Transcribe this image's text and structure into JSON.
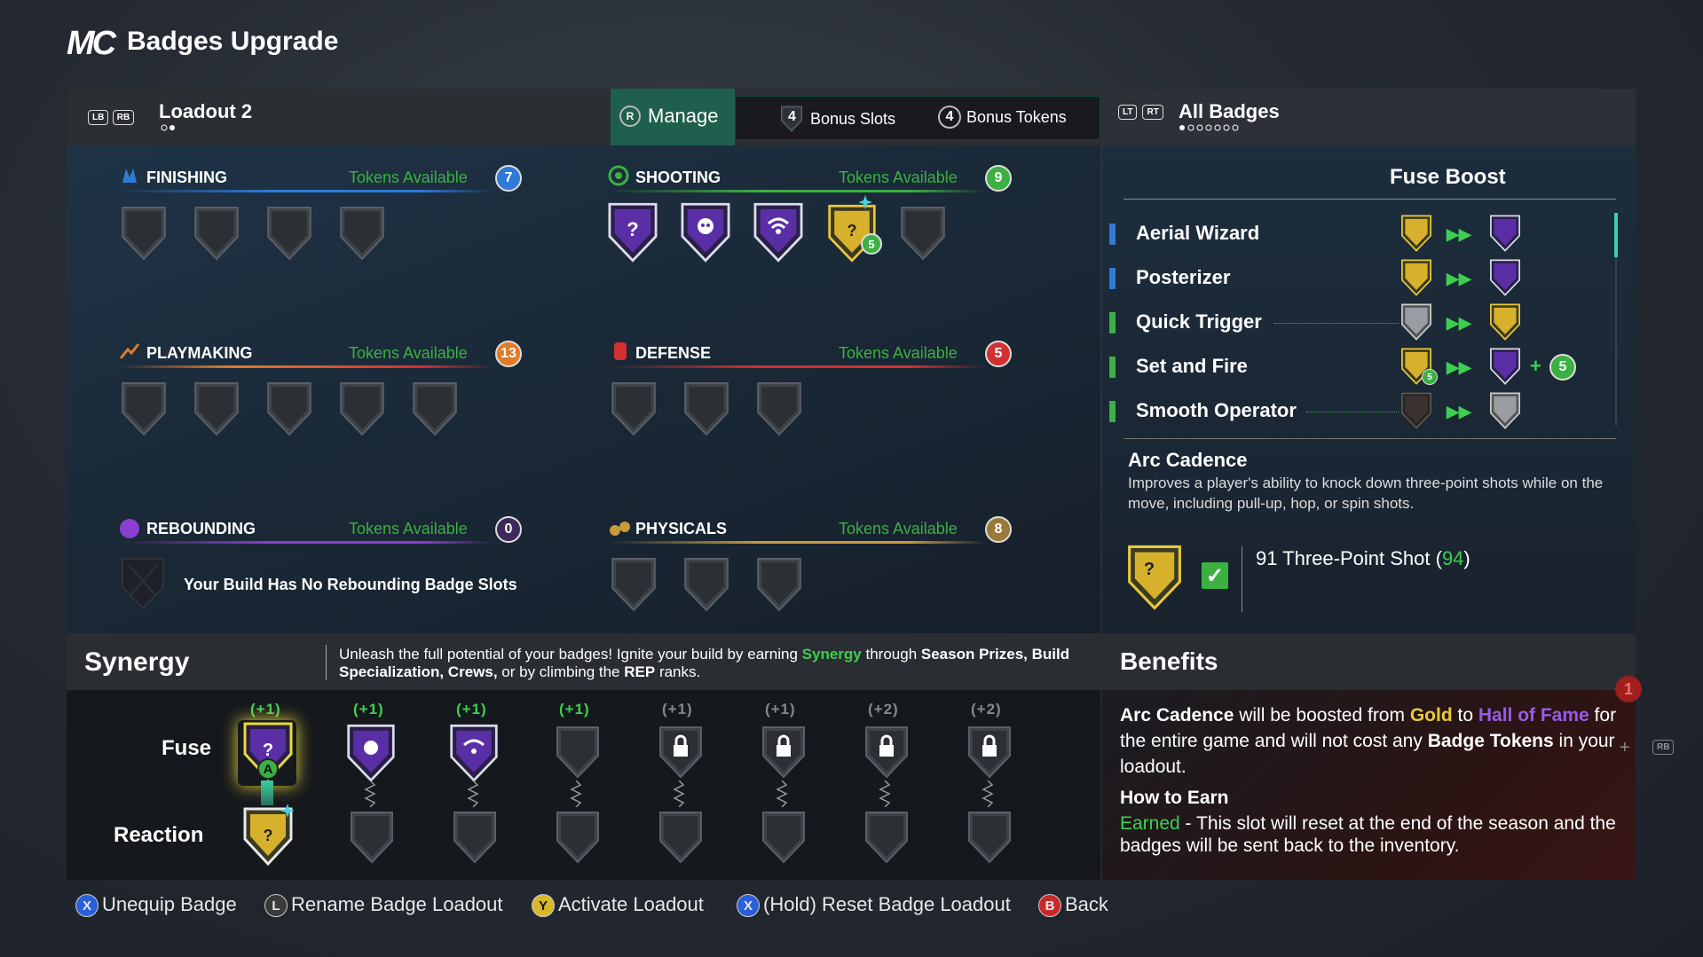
{
  "header": {
    "logo": "MC",
    "title": "Badges Upgrade"
  },
  "topbar": {
    "lb": "LB",
    "rb": "RB",
    "loadout_name": "Loadout 2",
    "manage_btn": "R",
    "manage_label": "Manage",
    "bonus_slots_count": "4",
    "bonus_slots_label": "Bonus Slots",
    "bonus_tokens_count": "4",
    "bonus_tokens_label": "Bonus Tokens",
    "lt": "LT",
    "rt": "RT",
    "all_badges_label": "All Badges"
  },
  "categories": {
    "finishing": {
      "name": "FINISHING",
      "tokens_label": "Tokens Available",
      "tokens": "7",
      "color": "#2f7ad8"
    },
    "shooting": {
      "name": "SHOOTING",
      "tokens_label": "Tokens Available",
      "tokens": "9",
      "color": "#3cb043",
      "badge_count": "5"
    },
    "playmaking": {
      "name": "PLAYMAKING",
      "tokens_label": "Tokens Available",
      "tokens": "13",
      "color": "#e07b2a"
    },
    "defense": {
      "name": "DEFENSE",
      "tokens_label": "Tokens Available",
      "tokens": "5",
      "color": "#d33030"
    },
    "rebounding": {
      "name": "REBOUNDING",
      "tokens_label": "Tokens Available",
      "tokens": "0",
      "color": "#8a3fd0",
      "empty_message": "Your Build Has No Rebounding Badge Slots"
    },
    "physicals": {
      "name": "PHYSICALS",
      "tokens_label": "Tokens Available",
      "tokens": "8",
      "color": "#c79a3a"
    }
  },
  "fuse_boost": {
    "title": "Fuse Boost",
    "rows": [
      {
        "label": "Aerial Wizard",
        "color": "#2f7ad8"
      },
      {
        "label": "Posterizer",
        "color": "#2f7ad8"
      },
      {
        "label": "Quick Trigger",
        "color": "#3cb043"
      },
      {
        "label": "Set and Fire",
        "color": "#3cb043",
        "count": "5",
        "extra_count": "5"
      },
      {
        "label": "Smooth Operator",
        "color": "#3cb043"
      }
    ],
    "plus": "+",
    "selected_name": "Arc Cadence",
    "selected_desc": "Improves a player's ability to knock down three-point shots while on the move, including pull-up, hop, or spin shots.",
    "attribute_text": "91 Three-Point Shot (",
    "attribute_value": "94",
    "attribute_close": ")"
  },
  "synergy": {
    "title": "Synergy",
    "desc_1": "Unleash the full potential of your badges! Ignite your build by earning ",
    "desc_highlight": "Synergy",
    "desc_2": " through ",
    "desc_b1": "Season Prizes, Build Specialization, Crews,",
    "desc_3": " or by climbing the ",
    "desc_b2": "REP",
    "desc_4": " ranks.",
    "fuse_label": "Fuse",
    "reaction_label": "Reaction",
    "selected_button": "A",
    "plus_labels": [
      "(+1)",
      "(+1)",
      "(+1)",
      "(+1)",
      "(+1)",
      "(+1)",
      "(+2)",
      "(+2)"
    ]
  },
  "benefits": {
    "title": "Benefits",
    "badge_name": "Arc Cadence",
    "text_1": " will be boosted from ",
    "gold": "Gold",
    "text_2": " to ",
    "hof": "Hall of Fame",
    "text_3": " for the entire game and will not cost any ",
    "text_b": "Badge Tokens",
    "text_4": " in your loadout.",
    "how_title": "How to Earn",
    "earned": "Earned",
    "earned_text": " - This slot will reset at the end of the season and the badges will be sent back to the inventory.",
    "bg_number": "1",
    "rb": "RB",
    "plus": "+"
  },
  "footer": {
    "items": [
      {
        "btn": "X",
        "label": "Unequip Badge",
        "color": "#2a5fd8"
      },
      {
        "btn": "L",
        "label": "Rename Badge Loadout",
        "color": "#3a3a3a"
      },
      {
        "btn": "Y",
        "label": "Activate Loadout",
        "color": "#d8b82a"
      },
      {
        "btn": "X",
        "label": "(Hold) Reset Badge Loadout",
        "color": "#2a5fd8"
      },
      {
        "btn": "B",
        "label": "Back",
        "color": "#c82a2a"
      }
    ]
  }
}
